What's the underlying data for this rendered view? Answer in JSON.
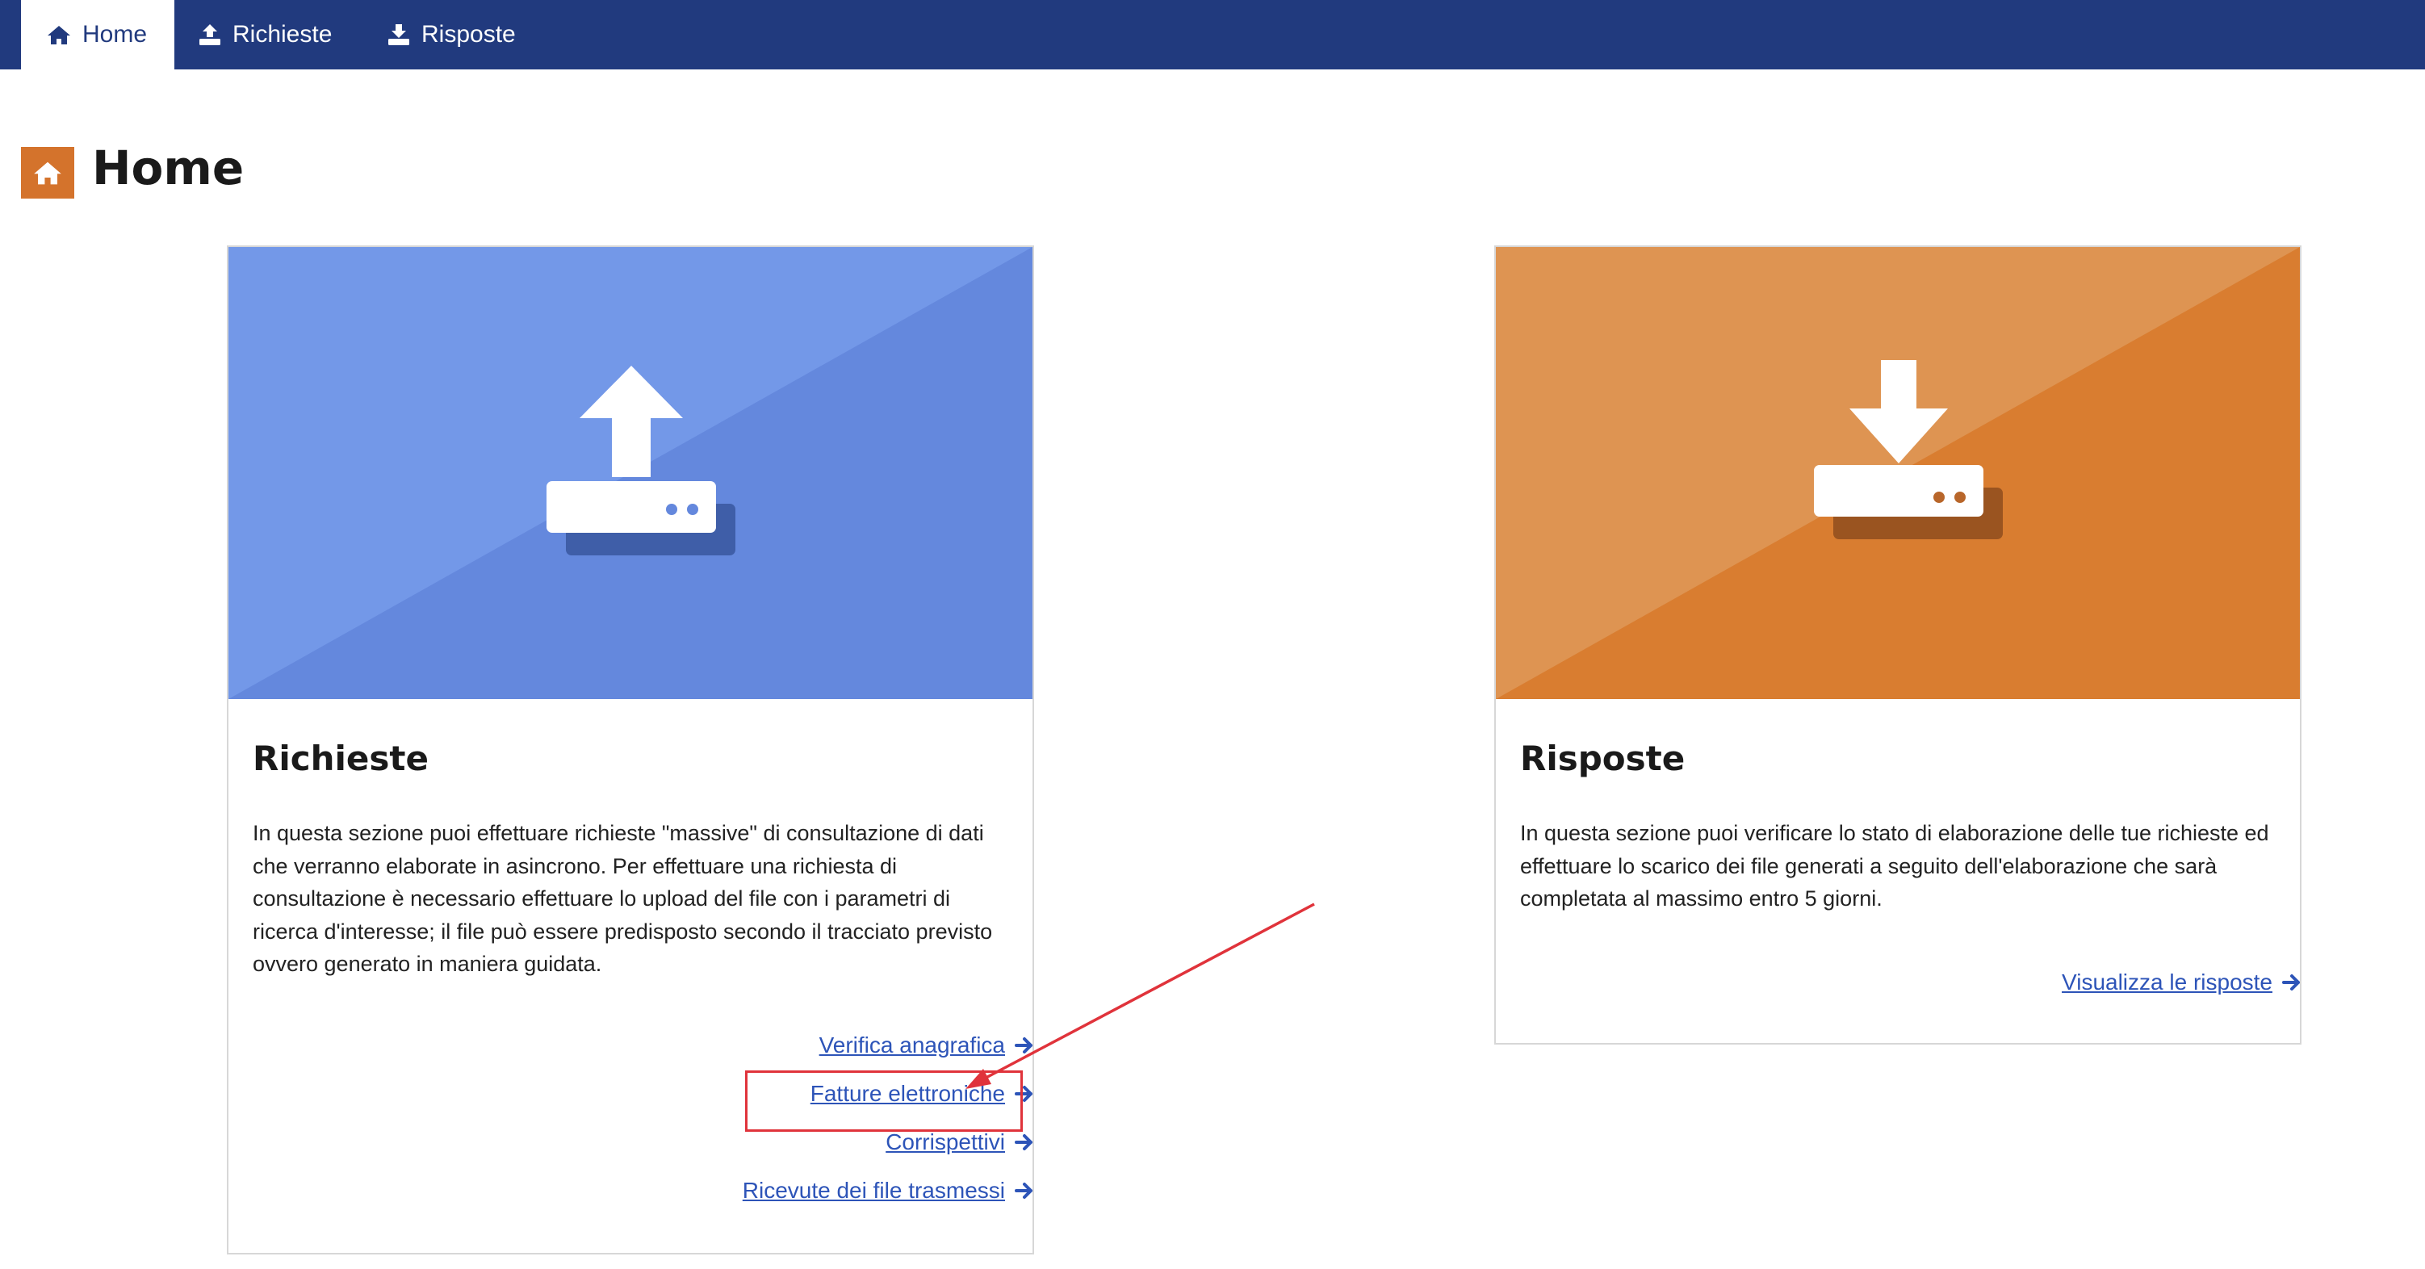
{
  "nav": {
    "tabs": [
      {
        "label": "Home",
        "icon": "home-icon",
        "active": true
      },
      {
        "label": "Richieste",
        "icon": "upload-icon",
        "active": false
      },
      {
        "label": "Risposte",
        "icon": "download-icon",
        "active": false
      }
    ]
  },
  "page": {
    "title": "Home",
    "icon": "home-icon"
  },
  "cards": {
    "richieste": {
      "title": "Richieste",
      "text": "In questa sezione puoi effettuare richieste \"massive\" di consultazione di dati che verranno elaborate in asincrono. Per effettuare una richiesta di consultazione è necessario effettuare lo upload del file con i parametri di ricerca d'interesse; il file può essere predisposto secondo il tracciato previsto ovvero generato in maniera guidata.",
      "icon": "upload-tray-icon",
      "links": [
        {
          "label": "Verifica anagrafica"
        },
        {
          "label": "Fatture elettroniche"
        },
        {
          "label": "Corrispettivi"
        },
        {
          "label": "Ricevute dei file trasmessi"
        }
      ]
    },
    "risposte": {
      "title": "Risposte",
      "text": "In questa sezione puoi verificare lo stato di elaborazione delle tue richieste ed effettuare lo scarico dei file generati a seguito dell'elaborazione che sarà completata al massimo entro 5 giorni.",
      "icon": "download-tray-icon",
      "links": [
        {
          "label": "Visualizza le risposte"
        }
      ]
    }
  },
  "colors": {
    "nav_bg": "#213a7e",
    "accent_orange": "#d4732c",
    "banner_blue": "#6488dd",
    "banner_orange": "#d97d30",
    "link": "#2d54b8",
    "annotation_red": "#e0333b"
  }
}
